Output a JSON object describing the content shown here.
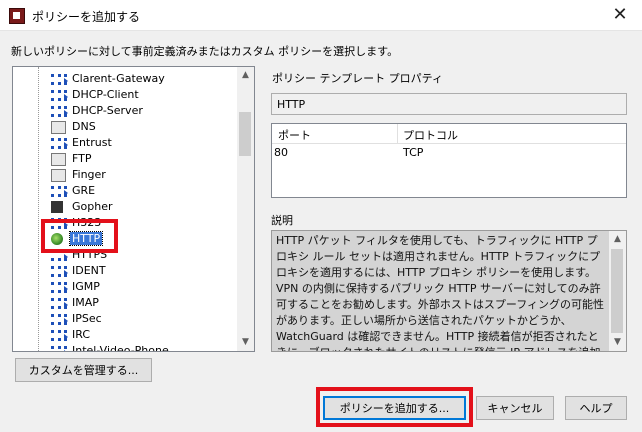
{
  "window": {
    "title": "ポリシーを追加する",
    "close_glyph": "✕"
  },
  "instructions": "新しいポリシーに対して事前定義済みまたはカスタム ポリシーを選択します。",
  "policy_list": {
    "items": [
      {
        "label": "Clarent-Gateway",
        "icon": "arrow"
      },
      {
        "label": "DHCP-Client",
        "icon": "arrow"
      },
      {
        "label": "DHCP-Server",
        "icon": "arrow"
      },
      {
        "label": "DNS",
        "icon": "box"
      },
      {
        "label": "Entrust",
        "icon": "arrow"
      },
      {
        "label": "FTP",
        "icon": "box"
      },
      {
        "label": "Finger",
        "icon": "box"
      },
      {
        "label": "GRE",
        "icon": "arrow"
      },
      {
        "label": "Gopher",
        "icon": "dark"
      },
      {
        "label": "H323",
        "icon": "arrow"
      },
      {
        "label": "HTTP",
        "icon": "globe",
        "selected": true
      },
      {
        "label": "HTTPS",
        "icon": "arrow"
      },
      {
        "label": "IDENT",
        "icon": "arrow"
      },
      {
        "label": "IGMP",
        "icon": "arrow"
      },
      {
        "label": "IMAP",
        "icon": "arrow"
      },
      {
        "label": "IPSec",
        "icon": "arrow"
      },
      {
        "label": "IRC",
        "icon": "arrow"
      },
      {
        "label": "Intel-Video-Phone",
        "icon": "arrow"
      }
    ],
    "scroll_up": "▲",
    "scroll_down": "▼"
  },
  "properties": {
    "title": "ポリシー テンプレート プロパティ",
    "policy_name": "HTTP",
    "table": {
      "columns": [
        "ポート",
        "プロトコル"
      ],
      "rows": [
        {
          "port": "80",
          "protocol": "TCP"
        }
      ]
    },
    "description_label": "説明",
    "description": "HTTP パケット フィルタを使用しても、トラフィックに HTTP プロキシ ルール セットは適用されません。HTTP トラフィックにプロキシを適用するには、HTTP プロキシ ポリシーを使用します。VPN の内側に保持するパブリック HTTP サーバーに対してのみ許可することをお勧めします。外部ホストはスプーフィングの可能性があります。正しい場所から送信されたパケットかどうか、WatchGuard は確認できません。HTTP 接続着信が拒否されたときに、ブロックされたサイトのリストに発信元 IP アドレスを追加するよう"
  },
  "buttons": {
    "manage_custom": "カスタムを管理する...",
    "add_policy": "ポリシーを追加する...",
    "cancel": "キャンセル",
    "help": "ヘルプ"
  },
  "colors": {
    "highlight": "#e3101a",
    "selection": "#3b78d8"
  }
}
